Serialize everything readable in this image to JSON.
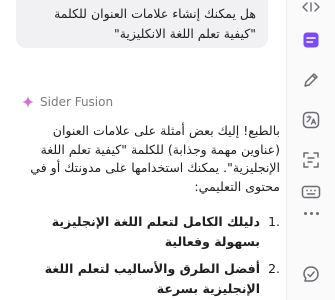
{
  "chat": {
    "user_message_line1": "هل يمكنك إنشاء علامات العنوان للكلمة",
    "user_message_line2": "\"كيفية تعلم اللغة الانكليزية\"",
    "assistant_name": "Sider Fusion",
    "answer_intro": "بالطبع! إليك بعض أمثلة على علامات العنوان (عناوين مهمة وجذابة) للكلمة \"كيفية تعلم اللغة الإنجليزية\". يمكنك استخدامها على مدونتك أو في محتوى التعليمي:",
    "list": [
      {
        "number": "1.",
        "text": "دليلك الكامل لتعلم اللغة الإنجليزية بسهولة وفعالية"
      },
      {
        "number": "2.",
        "text": "أفضل الطرق والأساليب لتعلم اللغة الإنجليزية بسرعة"
      }
    ]
  },
  "sidebar": {
    "expand_icon": "expand-arrows-icon",
    "items": [
      {
        "icon": "chat-icon",
        "active": true
      },
      {
        "icon": "write-icon",
        "active": false
      },
      {
        "icon": "translate-icon",
        "active": false
      },
      {
        "icon": "ocr-scan-icon",
        "active": false
      },
      {
        "icon": "keyboard-icon",
        "active": false
      },
      {
        "icon": "more-icon",
        "active": false
      },
      {
        "icon": "grammar-icon",
        "active": false
      }
    ]
  },
  "colors": {
    "accent": "#7a4bf6",
    "sparkle_start": "#b26df5",
    "sparkle_end": "#f2819a",
    "bubble_bg": "#f1f1f4",
    "icon_gray": "#6b6b73"
  }
}
